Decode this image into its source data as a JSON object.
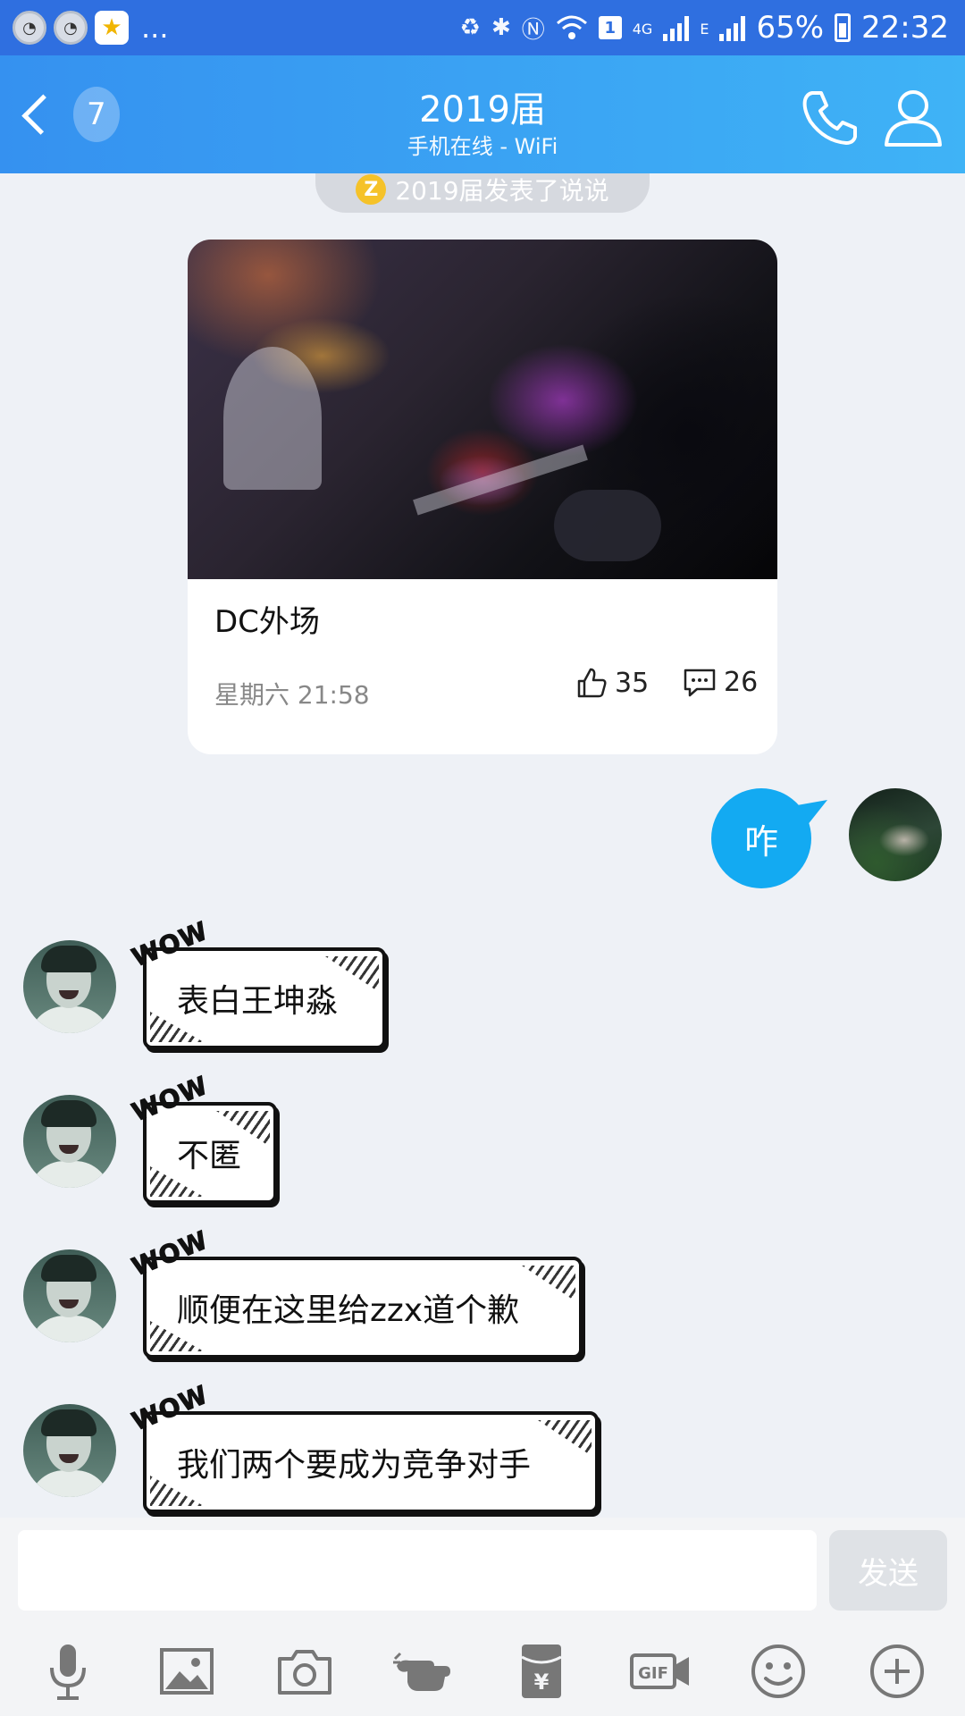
{
  "status_bar": {
    "battery": "65%",
    "time": "22:32",
    "sim_slot": "1",
    "network_4g": "4G",
    "network_e": "E",
    "overflow": "..."
  },
  "header": {
    "unread_count": "7",
    "title": "2019届",
    "subtitle": "手机在线 - WiFi"
  },
  "feed_notice": {
    "text": "2019届发表了说说"
  },
  "post_card": {
    "caption": "DC外场",
    "time": "星期六 21:58",
    "likes": "35",
    "comments": "26"
  },
  "my_message": {
    "text": "咋"
  },
  "messages": [
    {
      "text": "表白王坤淼",
      "sticker": "WOW"
    },
    {
      "text": "不匿",
      "sticker": "WOW"
    },
    {
      "text": "顺便在这里给zzx道个歉",
      "sticker": "WOW"
    },
    {
      "text": "我们两个要成为竞争对手",
      "sticker": "WOW"
    }
  ],
  "input": {
    "value": "",
    "send_label": "发送"
  },
  "toolbar": {
    "icons": [
      "microphone-icon",
      "image-icon",
      "camera-icon",
      "poke-icon",
      "red-packet-icon",
      "gif-icon",
      "emoji-icon",
      "plus-icon"
    ]
  },
  "colors": {
    "header_start": "#3591f0",
    "header_end": "#3fb3f6",
    "my_bubble": "#13aaf2",
    "background": "#eef1f6"
  }
}
